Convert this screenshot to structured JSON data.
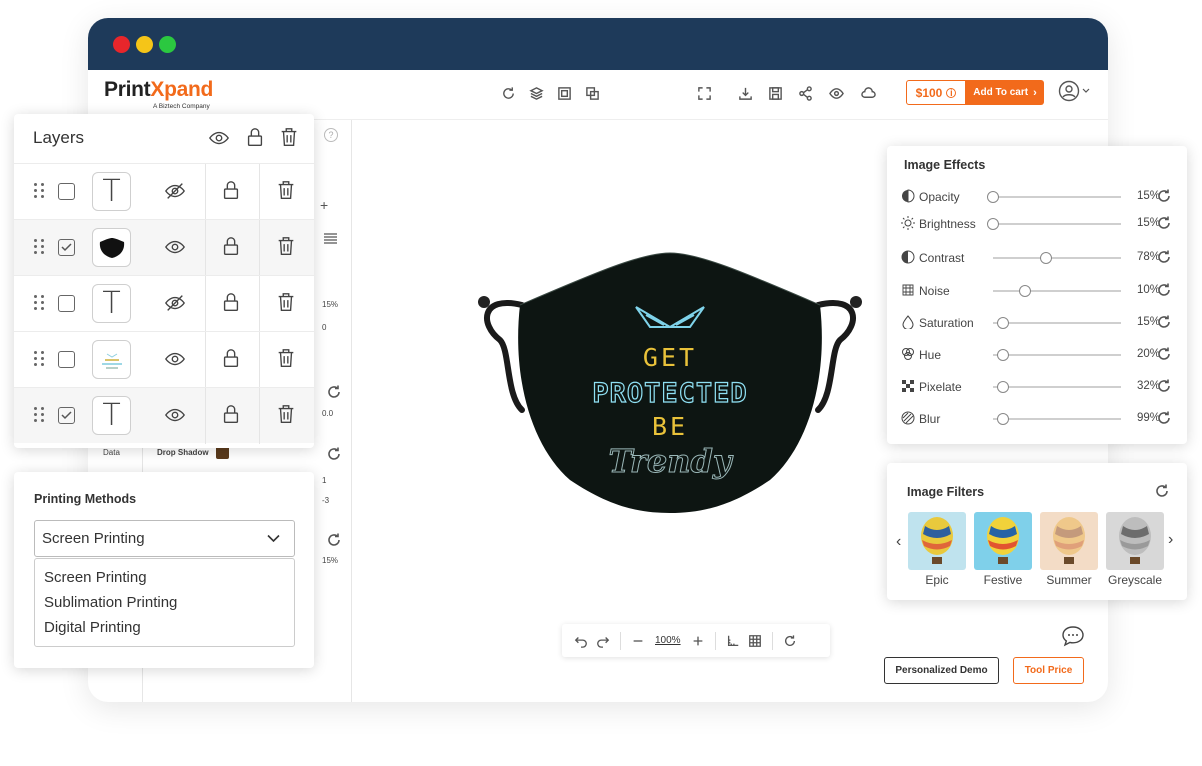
{
  "window": {
    "controls": [
      "close",
      "minimize",
      "maximize"
    ]
  },
  "brand": {
    "name_part1": "Print",
    "name_x": "X",
    "name_part2": "pand",
    "tagline": "A Biztech Company",
    "accent": "#f26a1b",
    "titlebar_color": "#1e3a5a"
  },
  "toolbar": {
    "center_icons": [
      "refresh-icon",
      "layers-icon",
      "image-frame-icon",
      "duplicate-icon"
    ],
    "right_icons": [
      "fullscreen-icon",
      "download-icon",
      "save-icon",
      "share-icon",
      "preview-icon",
      "cloud-icon"
    ],
    "price": "$100",
    "add_to_cart": "Add To cart"
  },
  "background_panel": {
    "data_label": "Data",
    "drop_shadow_label": "Drop Shadow",
    "values": [
      "15%",
      "0",
      "0.0",
      "1",
      "-3",
      "15%"
    ]
  },
  "layers": {
    "title": "Layers",
    "header_icons": [
      "eye-icon",
      "lock-icon",
      "trash-icon"
    ],
    "rows": [
      {
        "checked": false,
        "thumb": "text",
        "visible": false
      },
      {
        "checked": true,
        "thumb": "mask",
        "visible": true
      },
      {
        "checked": false,
        "thumb": "text",
        "visible": false
      },
      {
        "checked": false,
        "thumb": "image",
        "visible": true
      },
      {
        "checked": true,
        "thumb": "text",
        "visible": true
      }
    ]
  },
  "printing": {
    "title": "Printing Methods",
    "selected": "Screen Printing",
    "options": [
      "Screen Printing",
      "Sublimation Printing",
      "Digital Printing"
    ]
  },
  "canvas": {
    "mask_text": {
      "line1": "GET",
      "line2": "PROTECTED",
      "line3": "BE",
      "line4": "Trendy"
    }
  },
  "effects": {
    "title": "Image Effects",
    "items": [
      {
        "label": "Opacity",
        "value": "15%",
        "level": 0.0
      },
      {
        "label": "Brightness",
        "value": "15%",
        "level": 0.0
      },
      {
        "label": "Contrast",
        "value": "78%",
        "level": 0.43
      },
      {
        "label": "Noise",
        "value": "10%",
        "level": 0.26
      },
      {
        "label": "Saturation",
        "value": "15%",
        "level": 0.08
      },
      {
        "label": "Hue",
        "value": "20%",
        "level": 0.08
      },
      {
        "label": "Pixelate",
        "value": "32%",
        "level": 0.08
      },
      {
        "label": "Blur",
        "value": "99%",
        "level": 0.08
      }
    ]
  },
  "filters": {
    "title": "Image Filters",
    "items": [
      {
        "label": "Epic"
      },
      {
        "label": "Festive"
      },
      {
        "label": "Summer"
      },
      {
        "label": "Greyscale"
      }
    ]
  },
  "zoom": {
    "level": "100%"
  },
  "footer": {
    "demo": "Personalized Demo",
    "tool_price": "Tool Price"
  }
}
